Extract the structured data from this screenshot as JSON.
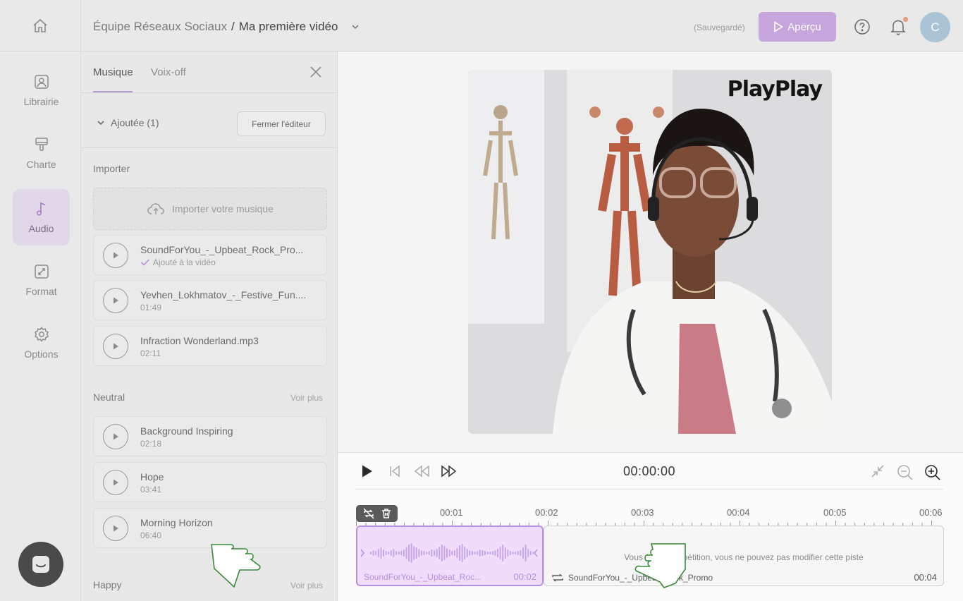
{
  "header": {
    "team": "Équipe Réseaux Sociaux",
    "separator": "/",
    "project": "Ma première vidéo",
    "saved": "(Sauvegardé)",
    "preview_button": "Aperçu",
    "avatar_initial": "C",
    "accent_color": "#c7a6dd"
  },
  "nav": {
    "items": [
      {
        "label": "Librairie",
        "icon": "image-icon"
      },
      {
        "label": "Charte",
        "icon": "brush-icon"
      },
      {
        "label": "Audio",
        "icon": "music-note-icon",
        "active": true
      },
      {
        "label": "Format",
        "icon": "resize-icon"
      },
      {
        "label": "Options",
        "icon": "gear-icon"
      }
    ]
  },
  "panel": {
    "tabs": [
      {
        "label": "Musique",
        "active": true
      },
      {
        "label": "Voix-off",
        "active": false
      }
    ],
    "added_label": "Ajoutée (1)",
    "close_editor": "Fermer l'éditeur",
    "import_section": "Importer",
    "import_button": "Importer votre musique",
    "imported_tracks": [
      {
        "name": "SoundForYou_-_Upbeat_Rock_Pro...",
        "status": "Ajouté à la vidéo"
      },
      {
        "name": "Yevhen_Lokhmatov_-_Festive_Fun....",
        "duration": "01:49"
      },
      {
        "name": "Infraction Wonderland.mp3",
        "duration": "02:11"
      }
    ],
    "neutral_section": "Neutral",
    "voir_plus": "Voir plus",
    "neutral_tracks": [
      {
        "name": "Background Inspiring",
        "duration": "02:18"
      },
      {
        "name": "Hope",
        "duration": "03:41"
      },
      {
        "name": "Morning Horizon",
        "duration": "06:40"
      }
    ],
    "happy_section": "Happy",
    "voir_plus_2": "Voir plus"
  },
  "video": {
    "logo": "PlayPlay"
  },
  "timeline": {
    "current_time": "00:00:00",
    "ruler": [
      "00:01",
      "00:02",
      "00:03",
      "00:04",
      "00:05",
      "00:06"
    ],
    "clip1": {
      "name": "SoundForYou_-_Upbeat_Roc...",
      "duration": "00:02"
    },
    "clip2": {
      "message": "Vous êtes en répétition, vous ne pouvez pas modifier cette piste",
      "name": "SoundForYou_-_Upbeat_Rock_Promo",
      "duration": "00:04"
    }
  }
}
